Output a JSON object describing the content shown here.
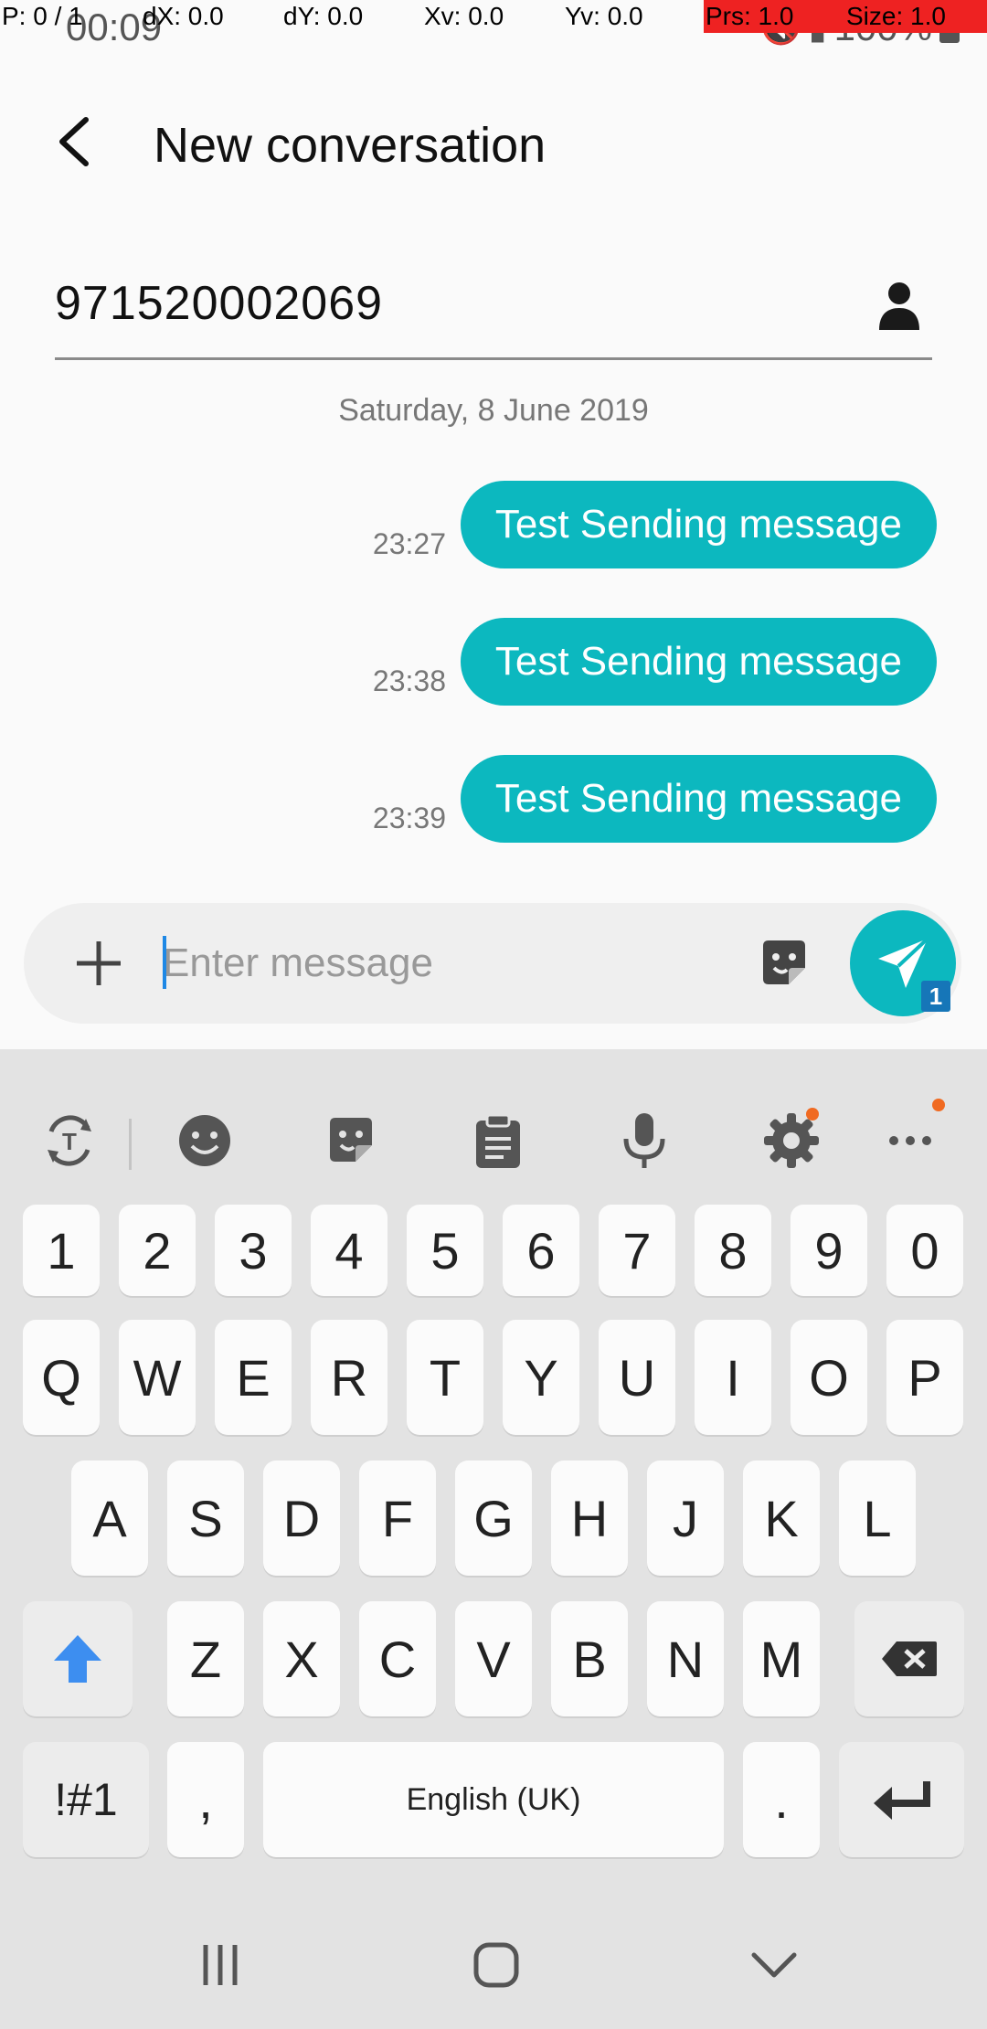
{
  "status": {
    "time": "00:09",
    "battery": "100%"
  },
  "debug": {
    "pointer": "P: 0 / 1",
    "dx": "dX: 0.0",
    "dy": "dY: 0.0",
    "xv": "Xv: 0.0",
    "yv": "Yv: 0.0",
    "prs": "Prs: 1.0",
    "size": "Size: 1.0"
  },
  "header": {
    "title": "New conversation"
  },
  "recipient": {
    "number": "971520002069"
  },
  "conversation": {
    "date": "Saturday, 8 June 2019",
    "messages": [
      {
        "time": "23:27",
        "text": "Test Sending message"
      },
      {
        "time": "23:38",
        "text": "Test Sending message"
      },
      {
        "time": "23:39",
        "text": "Test Sending message"
      }
    ]
  },
  "composer": {
    "placeholder": "Enter message",
    "sim_badge": "1"
  },
  "keyboard": {
    "number_row": [
      "1",
      "2",
      "3",
      "4",
      "5",
      "6",
      "7",
      "8",
      "9",
      "0"
    ],
    "row1": [
      "Q",
      "W",
      "E",
      "R",
      "T",
      "Y",
      "U",
      "I",
      "O",
      "P"
    ],
    "row2": [
      "A",
      "S",
      "D",
      "F",
      "G",
      "H",
      "J",
      "K",
      "L"
    ],
    "row3": [
      "Z",
      "X",
      "C",
      "V",
      "B",
      "N",
      "M"
    ],
    "symbols_label": "!#1",
    "comma": ",",
    "space_label": "English (UK)",
    "period": "."
  },
  "colors": {
    "accent": "#0cb8bf",
    "sim_badge": "#1676b8",
    "notification_dot": "#f06a21",
    "shift_arrow": "#3d8ef0"
  }
}
